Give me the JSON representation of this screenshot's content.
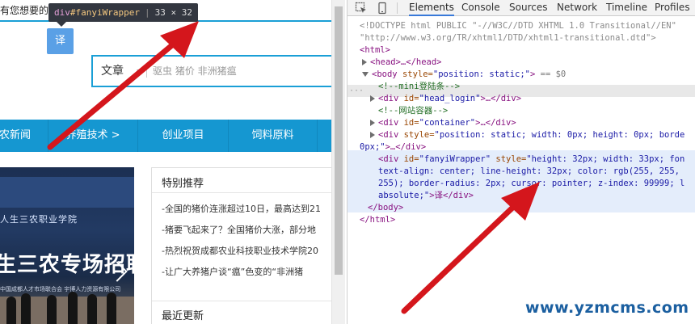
{
  "page": {
    "top_notice": "有您想要的信",
    "inspect_tip": {
      "tag": "div",
      "id": "#fanyiWrapper",
      "dims": "33 × 32"
    },
    "fanyi_label": "译",
    "search": {
      "category": "文章",
      "hot_words": "驱虫  猪价  非洲猪瘟"
    },
    "nav": [
      "农新闻",
      "养殖技术 >",
      "创业项目",
      "饲料原料"
    ],
    "banner": {
      "line1": "人生三农职业学院",
      "line2": "生三农专场招聘",
      "caption": "中国成都人才市场联合会  宇博人力资源有限公司"
    },
    "panel": {
      "title": "特别推荐",
      "news": [
        "-全国的猪价连涨超过10日，最高达到21",
        "-猪要飞起来了？全国猪价大涨，部分地",
        "-热烈祝贺成都农业科技职业技术学院20",
        "-让广大养猪户谈“瘟”色变的“非洲猪"
      ],
      "title2": "最近更新"
    }
  },
  "devtools": {
    "tabs": [
      "Elements",
      "Console",
      "Sources",
      "Network",
      "Timeline",
      "Profiles"
    ],
    "active_tab": "Elements",
    "lines": {
      "doctype1": "<!DOCTYPE html PUBLIC \"-//W3C//DTD XHTML 1.0 Transitional//EN\"",
      "doctype2": "\"http://www.w3.org/TR/xhtml1/DTD/xhtml1-transitional.dtd\">",
      "html_open": "<html>",
      "head": "<head>…</head>",
      "body_open_tag": "<body ",
      "body_attr": "style=",
      "body_val": "\"position: static;\"",
      "body_close": ">",
      "body_eq": "== $0",
      "comment_login": "<!--mini登陆条-->",
      "div_head_login_a": "<div ",
      "div_head_login_b": "id=",
      "div_head_login_c": "\"head_login\"",
      "div_head_login_d": ">…</div>",
      "comment_container": "<!--网站容器-->",
      "div_container_c": "\"container\"",
      "div_container_d": ">…</div>",
      "div_static_a": "<div ",
      "div_static_b": "style=",
      "div_static_c": "\"position: static; width: 0px; height: 0px; borde",
      "div_static_wrap": "0px;\"",
      "div_static_d": ">…</div>",
      "fanyi_a": "<div ",
      "fanyi_b": "id=",
      "fanyi_c": "\"fanyiWrapper\"",
      "fanyi_d": " style=",
      "fanyi_e": "\"height: 32px; width: 33px; fon",
      "fanyi_l2": "text-align: center; line-height: 32px; color: rgb(255, 255,",
      "fanyi_l3": "255); border-radius: 2px; cursor: pointer; z-index: 99999; l",
      "fanyi_l4": "absolute;\"",
      "fanyi_close": ">译</div>",
      "body_end": "</body>",
      "html_end": "</html>"
    }
  },
  "watermark": "www.yzmcms.com",
  "colors": {
    "accent": "#1597d1",
    "arrow": "#d4161c",
    "selected": "#e4edfb"
  }
}
